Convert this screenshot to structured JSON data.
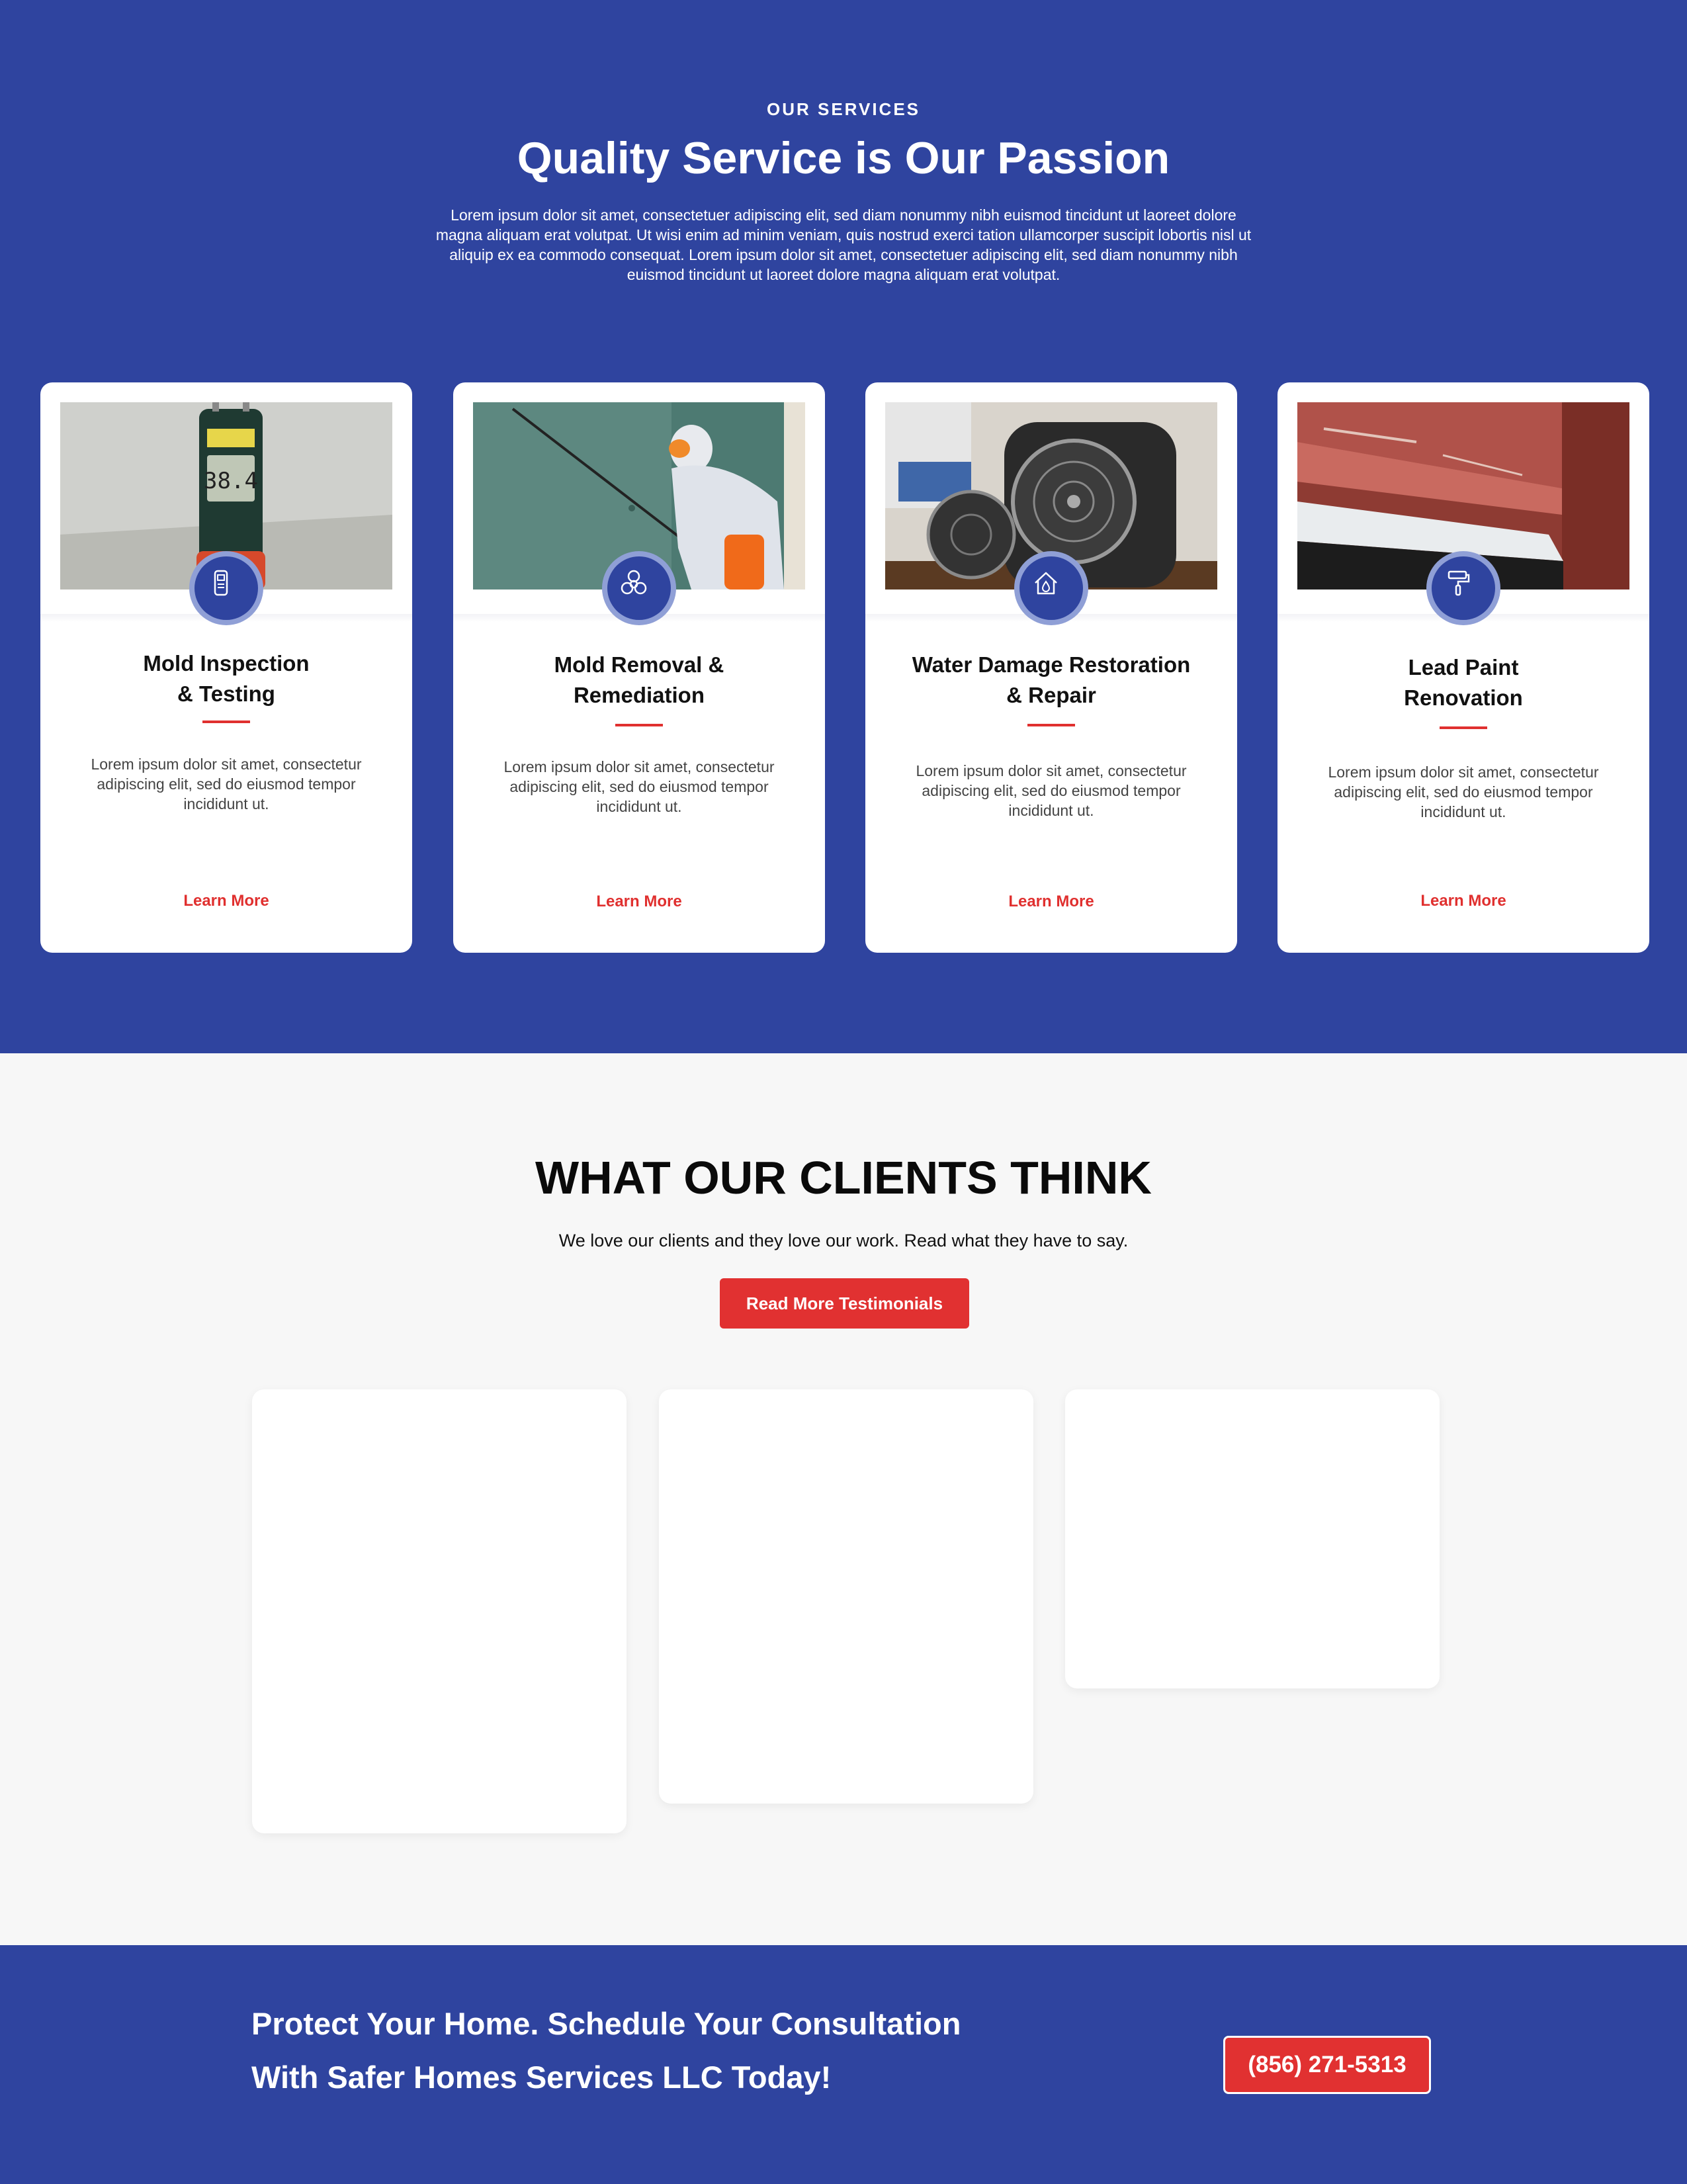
{
  "services": {
    "eyebrow": "OUR SERVICES",
    "title": "Quality Service is Our Passion",
    "intro": "Lorem ipsum dolor sit amet, consectetuer adipiscing elit, sed diam nonummy nibh euismod tincidunt ut laoreet dolore magna aliquam erat volutpat. Ut wisi enim ad minim veniam, quis nostrud exerci tation ullamcorper suscipit lobortis nisl ut aliquip ex ea commodo consequat. Lorem ipsum dolor sit amet, consectetuer adipiscing elit, sed diam nonummy nibh euismod tincidunt ut laoreet dolore magna aliquam erat volutpat.",
    "cards": [
      {
        "title_line1": "Mold Inspection",
        "title_line2": "& Testing",
        "text": "Lorem ipsum dolor sit amet, consectetur adipiscing elit, sed do eiusmod tempor incididunt ut.",
        "link": "Learn More",
        "icon": "moisture-meter-icon",
        "photo": "moisture-meter-photo"
      },
      {
        "title_line1": "Mold Removal &",
        "title_line2": "Remediation",
        "text": "Lorem ipsum dolor sit amet, consectetur adipiscing elit, sed do eiusmod tempor incididunt ut.",
        "link": "Learn More",
        "icon": "biohazard-icon",
        "photo": "mold-remediation-worker-photo"
      },
      {
        "title_line1": "Water Damage Restoration",
        "title_line2": "& Repair",
        "text": "Lorem ipsum dolor sit amet, consectetur adipiscing elit, sed do eiusmod tempor incididunt ut.",
        "link": "Learn More",
        "icon": "house-water-drop-icon",
        "photo": "drying-fans-photo"
      },
      {
        "title_line1": "Lead Paint",
        "title_line2": "Renovation",
        "text": "Lorem ipsum dolor sit amet, consectetur adipiscing elit, sed do eiusmod tempor incididunt ut.",
        "link": "Learn More",
        "icon": "paint-roller-icon",
        "photo": "peeling-paint-photo"
      }
    ]
  },
  "clients": {
    "title": "WHAT OUR CLIENTS THINK",
    "subtitle": "We love our clients and they love our work. Read what they have to say.",
    "button": "Read More Testimonials"
  },
  "cta": {
    "line1": "Protect Your Home. Schedule Your Consultation",
    "line2": "With Safer Homes Services LLC Today!",
    "phone": "(856) 271-5313"
  },
  "colors": {
    "brand_blue": "#2f449f",
    "accent_red": "#e13131",
    "background": "#f7f7f7"
  }
}
